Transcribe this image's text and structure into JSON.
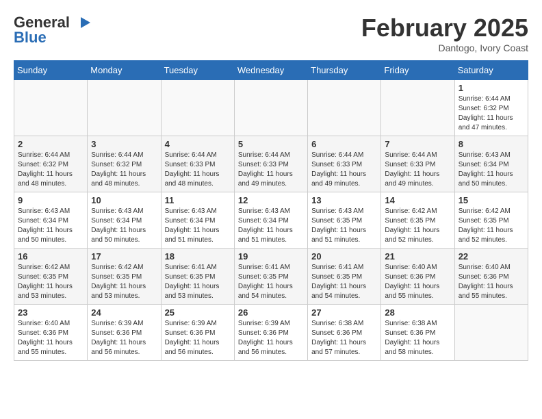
{
  "header": {
    "logo_line1": "General",
    "logo_line2": "Blue",
    "month": "February 2025",
    "location": "Dantogo, Ivory Coast"
  },
  "days_of_week": [
    "Sunday",
    "Monday",
    "Tuesday",
    "Wednesday",
    "Thursday",
    "Friday",
    "Saturday"
  ],
  "weeks": [
    [
      {
        "day": "",
        "info": ""
      },
      {
        "day": "",
        "info": ""
      },
      {
        "day": "",
        "info": ""
      },
      {
        "day": "",
        "info": ""
      },
      {
        "day": "",
        "info": ""
      },
      {
        "day": "",
        "info": ""
      },
      {
        "day": "1",
        "info": "Sunrise: 6:44 AM\nSunset: 6:32 PM\nDaylight: 11 hours\nand 47 minutes."
      }
    ],
    [
      {
        "day": "2",
        "info": "Sunrise: 6:44 AM\nSunset: 6:32 PM\nDaylight: 11 hours\nand 48 minutes."
      },
      {
        "day": "3",
        "info": "Sunrise: 6:44 AM\nSunset: 6:32 PM\nDaylight: 11 hours\nand 48 minutes."
      },
      {
        "day": "4",
        "info": "Sunrise: 6:44 AM\nSunset: 6:33 PM\nDaylight: 11 hours\nand 48 minutes."
      },
      {
        "day": "5",
        "info": "Sunrise: 6:44 AM\nSunset: 6:33 PM\nDaylight: 11 hours\nand 49 minutes."
      },
      {
        "day": "6",
        "info": "Sunrise: 6:44 AM\nSunset: 6:33 PM\nDaylight: 11 hours\nand 49 minutes."
      },
      {
        "day": "7",
        "info": "Sunrise: 6:44 AM\nSunset: 6:33 PM\nDaylight: 11 hours\nand 49 minutes."
      },
      {
        "day": "8",
        "info": "Sunrise: 6:43 AM\nSunset: 6:34 PM\nDaylight: 11 hours\nand 50 minutes."
      }
    ],
    [
      {
        "day": "9",
        "info": "Sunrise: 6:43 AM\nSunset: 6:34 PM\nDaylight: 11 hours\nand 50 minutes."
      },
      {
        "day": "10",
        "info": "Sunrise: 6:43 AM\nSunset: 6:34 PM\nDaylight: 11 hours\nand 50 minutes."
      },
      {
        "day": "11",
        "info": "Sunrise: 6:43 AM\nSunset: 6:34 PM\nDaylight: 11 hours\nand 51 minutes."
      },
      {
        "day": "12",
        "info": "Sunrise: 6:43 AM\nSunset: 6:34 PM\nDaylight: 11 hours\nand 51 minutes."
      },
      {
        "day": "13",
        "info": "Sunrise: 6:43 AM\nSunset: 6:35 PM\nDaylight: 11 hours\nand 51 minutes."
      },
      {
        "day": "14",
        "info": "Sunrise: 6:42 AM\nSunset: 6:35 PM\nDaylight: 11 hours\nand 52 minutes."
      },
      {
        "day": "15",
        "info": "Sunrise: 6:42 AM\nSunset: 6:35 PM\nDaylight: 11 hours\nand 52 minutes."
      }
    ],
    [
      {
        "day": "16",
        "info": "Sunrise: 6:42 AM\nSunset: 6:35 PM\nDaylight: 11 hours\nand 53 minutes."
      },
      {
        "day": "17",
        "info": "Sunrise: 6:42 AM\nSunset: 6:35 PM\nDaylight: 11 hours\nand 53 minutes."
      },
      {
        "day": "18",
        "info": "Sunrise: 6:41 AM\nSunset: 6:35 PM\nDaylight: 11 hours\nand 53 minutes."
      },
      {
        "day": "19",
        "info": "Sunrise: 6:41 AM\nSunset: 6:35 PM\nDaylight: 11 hours\nand 54 minutes."
      },
      {
        "day": "20",
        "info": "Sunrise: 6:41 AM\nSunset: 6:35 PM\nDaylight: 11 hours\nand 54 minutes."
      },
      {
        "day": "21",
        "info": "Sunrise: 6:40 AM\nSunset: 6:36 PM\nDaylight: 11 hours\nand 55 minutes."
      },
      {
        "day": "22",
        "info": "Sunrise: 6:40 AM\nSunset: 6:36 PM\nDaylight: 11 hours\nand 55 minutes."
      }
    ],
    [
      {
        "day": "23",
        "info": "Sunrise: 6:40 AM\nSunset: 6:36 PM\nDaylight: 11 hours\nand 55 minutes."
      },
      {
        "day": "24",
        "info": "Sunrise: 6:39 AM\nSunset: 6:36 PM\nDaylight: 11 hours\nand 56 minutes."
      },
      {
        "day": "25",
        "info": "Sunrise: 6:39 AM\nSunset: 6:36 PM\nDaylight: 11 hours\nand 56 minutes."
      },
      {
        "day": "26",
        "info": "Sunrise: 6:39 AM\nSunset: 6:36 PM\nDaylight: 11 hours\nand 56 minutes."
      },
      {
        "day": "27",
        "info": "Sunrise: 6:38 AM\nSunset: 6:36 PM\nDaylight: 11 hours\nand 57 minutes."
      },
      {
        "day": "28",
        "info": "Sunrise: 6:38 AM\nSunset: 6:36 PM\nDaylight: 11 hours\nand 58 minutes."
      },
      {
        "day": "",
        "info": ""
      }
    ]
  ]
}
